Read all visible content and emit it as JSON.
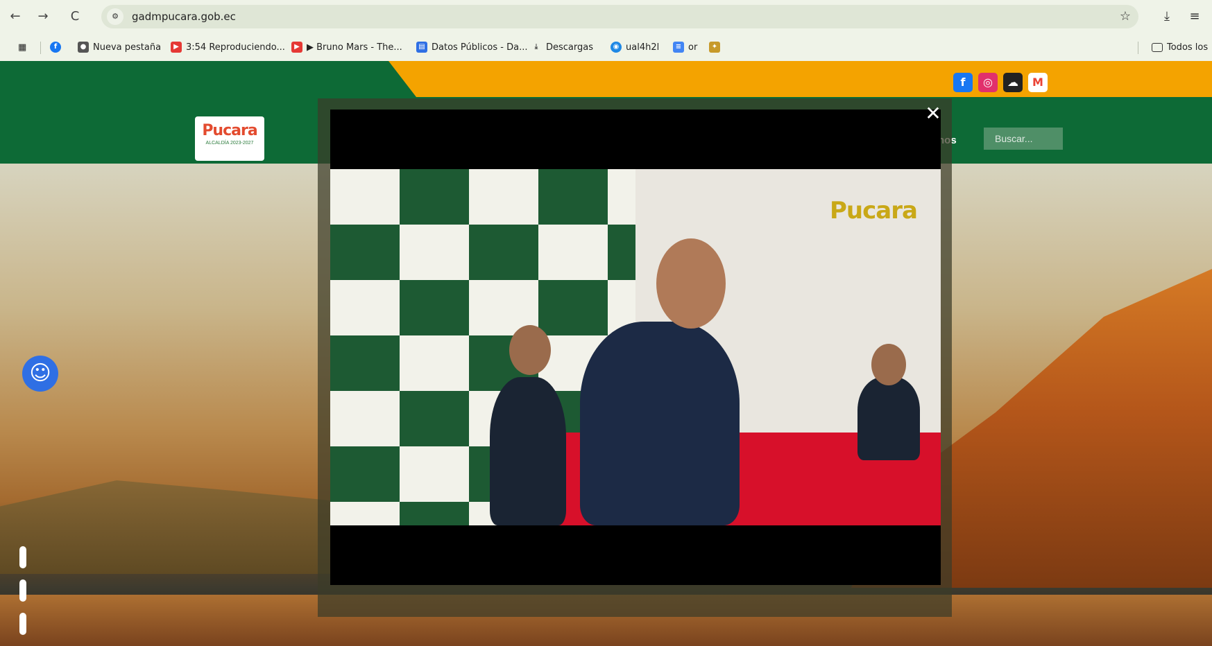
{
  "browser": {
    "url": "gadmpucara.gob.ec",
    "icons": {
      "back": "←",
      "forward": "→",
      "reload": "C",
      "site_info": "⚙",
      "star": "☆",
      "download": "⤓",
      "menu": "≡"
    },
    "bookmarks": [
      {
        "label": "Nueva pestaña",
        "icon": "chrome-icon",
        "color": "#555555"
      },
      {
        "label": "3:54 Reproduciendo...",
        "icon": "youtube-icon",
        "color": "#e53935"
      },
      {
        "label": "▶ Bruno Mars - The...",
        "icon": "youtube-icon",
        "color": "#e53935"
      },
      {
        "label": "Datos Públicos - Da...",
        "icon": "data-icon",
        "color": "#2f6fe4"
      },
      {
        "label": "Descargas",
        "icon": "download-icon",
        "color": "#444444"
      },
      {
        "label": "ual4h2l",
        "icon": "mask-icon",
        "color": "#1e88e5"
      },
      {
        "label": "or",
        "icon": "docs-icon",
        "color": "#4285f4"
      }
    ],
    "all_bookmarks_label": "Todos los"
  },
  "site": {
    "logo_text": "Pucara",
    "logo_subtext": "ALCALDÍA 2023-2027",
    "menu_fragment": "nos",
    "search_placeholder": "Buscar...",
    "social": [
      {
        "name": "facebook",
        "glyph": "f",
        "color": "#1877f2"
      },
      {
        "name": "instagram",
        "glyph": "◎",
        "color": "#e1306c"
      },
      {
        "name": "soundcloud",
        "glyph": "☁",
        "color": "#222222"
      },
      {
        "name": "gmail",
        "glyph": "M",
        "color": "#ea4335"
      }
    ],
    "colors": {
      "green": "#0d6a36",
      "orange": "#f4a300"
    }
  },
  "modal": {
    "close_glyph": "✕",
    "video_wall_logo": "Pucara"
  }
}
